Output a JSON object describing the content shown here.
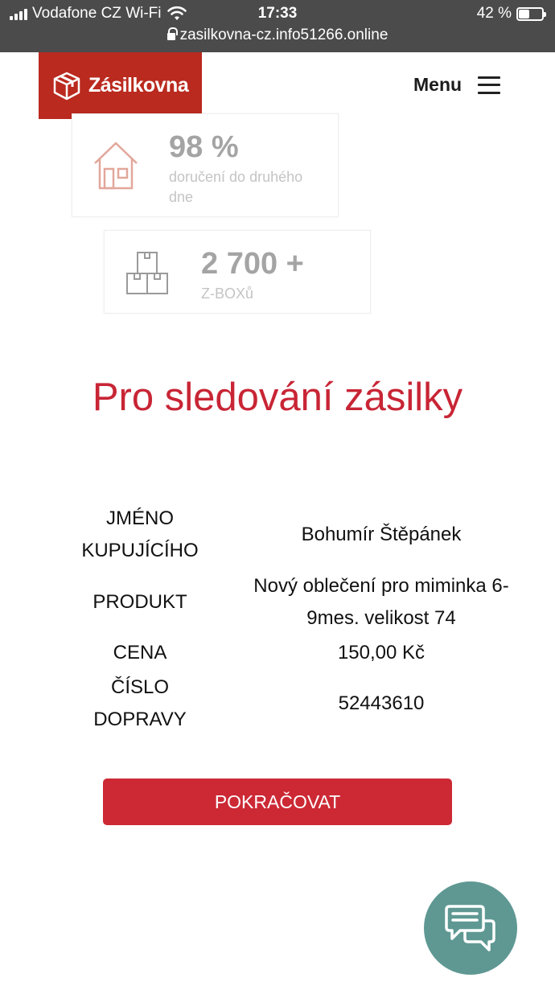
{
  "status_bar": {
    "carrier": "Vodafone CZ Wi-Fi",
    "time": "17:33",
    "battery": "42 %",
    "url": "zasilkovna-cz.info51266.online"
  },
  "header": {
    "logo_text": "Zásilkovna",
    "menu_label": "Menu"
  },
  "stats": [
    {
      "number": "98 %",
      "description": "doručení do druhého dne",
      "icon": "house-icon"
    },
    {
      "number": "2 700 +",
      "description": "Z-BOXů",
      "icon": "boxes-icon"
    }
  ],
  "title": "Pro sledování zásilky",
  "info": {
    "buyer_label": "JMÉNO KUPUJÍCÍHO",
    "buyer_value": "Bohumír Štěpánek",
    "product_label": "PRODUKT",
    "product_value": "Nový oblečení pro miminka 6-9mes. velikost 74",
    "price_label": "CENA",
    "price_value": "150,00 Kč",
    "shipping_label": "ČÍSLO DOPRAVY",
    "shipping_value": "52443610"
  },
  "continue_button": "POKRAČOVAT",
  "colors": {
    "brand_red": "#ba2a1f",
    "title_red": "#c82535",
    "button_red": "#cc2935",
    "chat_teal": "#5f9893"
  }
}
